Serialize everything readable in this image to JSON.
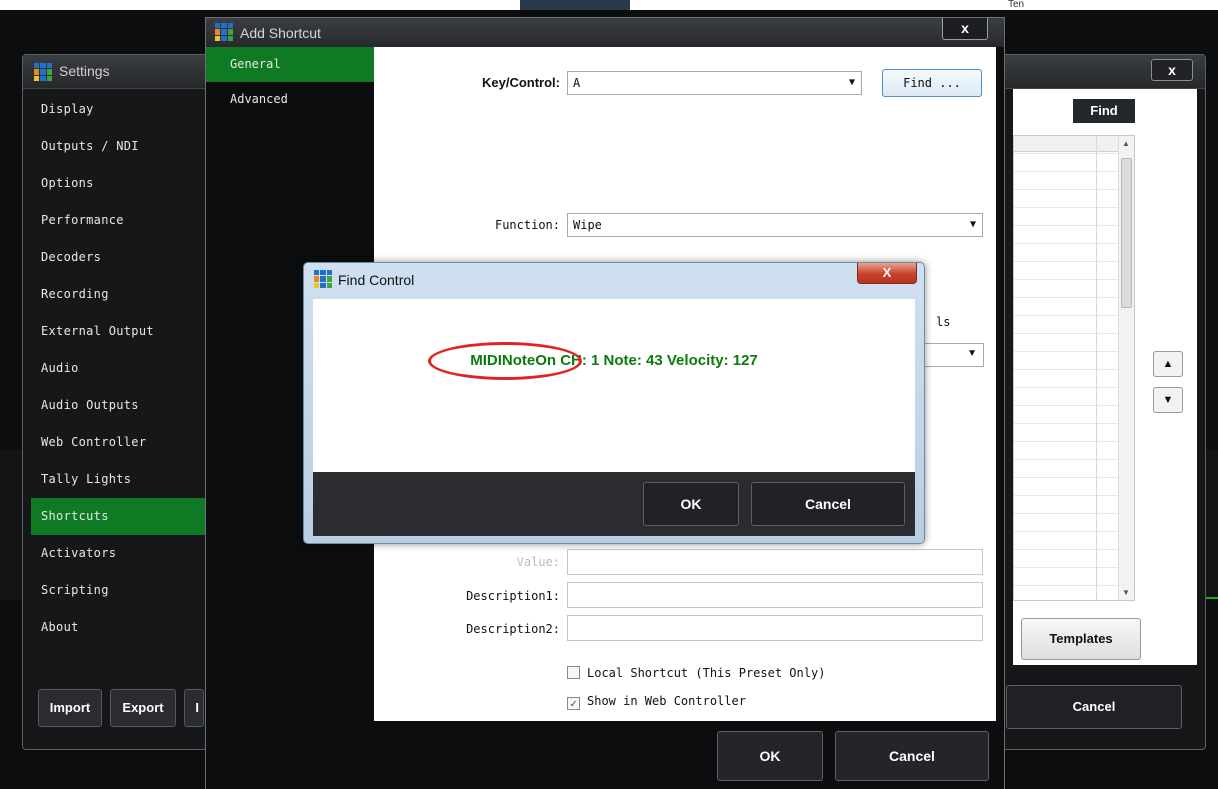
{
  "background": {
    "topbar_text": "Ten",
    "accent_green": "#0f7a24",
    "window_dark": "#151719"
  },
  "settings": {
    "title": "Settings",
    "logo_icon": "vmix-logo-icon",
    "close_label": "x",
    "nav_items": [
      {
        "label": "Display"
      },
      {
        "label": "Outputs / NDI"
      },
      {
        "label": "Options"
      },
      {
        "label": "Performance"
      },
      {
        "label": "Decoders"
      },
      {
        "label": "Recording"
      },
      {
        "label": "External Output"
      },
      {
        "label": "Audio"
      },
      {
        "label": "Audio Outputs"
      },
      {
        "label": "Web Controller"
      },
      {
        "label": "Tally Lights"
      },
      {
        "label": "Shortcuts"
      },
      {
        "label": "Activators"
      },
      {
        "label": "Scripting"
      },
      {
        "label": "About"
      }
    ],
    "active_nav": "Shortcuts",
    "import_label": "Import",
    "export_label": "Export",
    "third_button_label": "I",
    "find_label": "Find",
    "templates_label": "Templates",
    "cancel_label": "Cancel",
    "scroll_up_glyph": "▲",
    "scroll_down_glyph": "▼",
    "side_up_glyph": "▲",
    "side_down_glyph": "▼"
  },
  "add_shortcut": {
    "title": "Add Shortcut",
    "close_label": "x",
    "tabs": [
      {
        "label": "General"
      },
      {
        "label": "Advanced"
      }
    ],
    "active_tab": "General",
    "key_control_label": "Key/Control:",
    "key_control_value": "A",
    "find_button_label": "Find ...",
    "function_label": "Function:",
    "function_value": "Wipe",
    "partial_label_tail": "ls",
    "value_label": "Value:",
    "description1_label": "Description1:",
    "description2_label": "Description2:",
    "local_shortcut_label": "Local Shortcut (This Preset Only)",
    "local_shortcut_checked": false,
    "show_in_web_controller_label": "Show in Web Controller",
    "show_in_web_controller_checked": true,
    "ok_label": "OK",
    "cancel_label": "Cancel",
    "caret_glyph": "▼",
    "check_glyph": "✓"
  },
  "find_control": {
    "title": "Find Control",
    "close_label": "X",
    "midi_readout": "MIDINoteOn CH: 1 Note: 43 Velocity: 127",
    "highlight_color": "#e02424",
    "readout_color": "#0c7a0c",
    "ok_label": "OK",
    "cancel_label": "Cancel"
  }
}
